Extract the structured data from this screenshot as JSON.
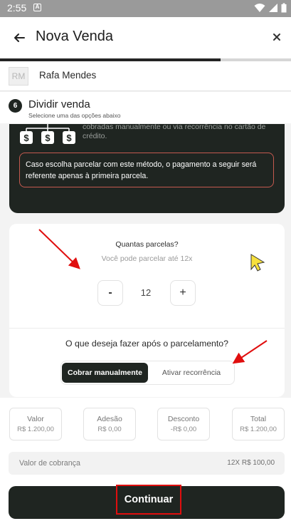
{
  "status_bar": {
    "time": "2:55"
  },
  "header": {
    "title": "Nova Venda",
    "back_icon": "arrow-left-icon",
    "close_icon": "close-icon"
  },
  "progress": {
    "fraction": 0.758
  },
  "customer": {
    "avatar_initials": "RM",
    "name": "Rafa Mendes"
  },
  "step": {
    "number": "6",
    "title": "Dividir venda",
    "subtitle": "Selecione uma das opções abaixo"
  },
  "info_card": {
    "description": "Separe o pagamento por parcelas que podem ser cobradas manualmente ou via recorrência no cartão de crédito.",
    "warning": "Caso escolha parcelar com este método, o pagamento a seguir será referente apenas à primeira parcela."
  },
  "installments": {
    "question": "Quantas parcelas?",
    "hint": "Você pode parcelar até 12x",
    "minus_label": "-",
    "plus_label": "+",
    "value": "12"
  },
  "after_installments": {
    "question": "O que deseja fazer após o parcelamento?",
    "options": [
      "Cobrar manualmente",
      "Ativar recorrência"
    ],
    "selected": "Cobrar manualmente"
  },
  "summary": {
    "valor": {
      "label": "Valor",
      "value": "R$ 1.200,00"
    },
    "adesao": {
      "label": "Adesão",
      "value": "R$ 0,00"
    },
    "desconto": {
      "label": "Desconto",
      "value": "-R$ 0,00"
    },
    "total": {
      "label": "Total",
      "value": "R$ 1.200,00"
    }
  },
  "charge": {
    "label": "Valor de cobrança",
    "value": "12X R$ 100,00"
  },
  "continue_label": "Continuar",
  "colors": {
    "dark": "#1f2521",
    "warning_border": "#c45a4f",
    "annotation_red": "#e00e0e",
    "cursor_yellow": "#f7e03d"
  }
}
